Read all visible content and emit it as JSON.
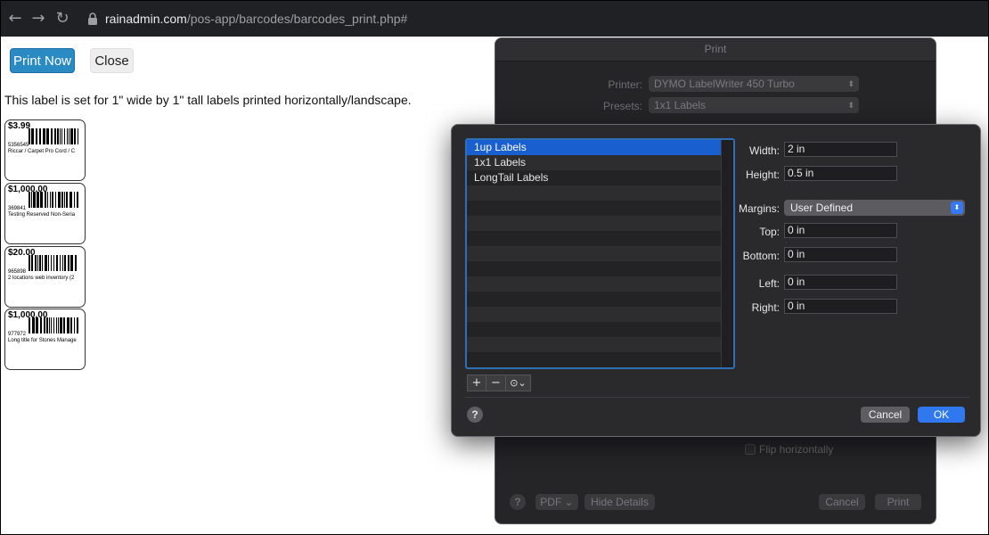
{
  "browser": {
    "url_host": "rainadmin.com",
    "url_path": "/pos-app/barcodes/barcodes_print.php#"
  },
  "page": {
    "print_now": "Print Now",
    "close": "Close",
    "note": "This label is set for 1\" wide by 1\" tall labels printed horizontally/landscape.",
    "labels": [
      {
        "price": "$3.99",
        "sku": "5356545",
        "desc": "Riccar / Carpet Pro Cord / C"
      },
      {
        "price": "$1,000.00",
        "sku": "369841",
        "desc": "Testing Reserved Non-Seria"
      },
      {
        "price": "$20.00",
        "sku": "965898",
        "desc": "2 locations web inventory (2"
      },
      {
        "price": "$1,000.00",
        "sku": "977972",
        "desc": "Long title for Stones Manage"
      }
    ]
  },
  "print_dialog": {
    "title": "Print",
    "printer_label": "Printer:",
    "printer_value": "DYMO LabelWriter 450 Turbo",
    "presets_label": "Presets:",
    "presets_value": "1x1 Labels",
    "flip_label": "Flip horizontally",
    "pdf_label": "PDF",
    "hide_details": "Hide Details",
    "cancel": "Cancel",
    "print": "Print"
  },
  "paper_sheet": {
    "list_items": [
      "1up Labels",
      "1x1 Labels",
      "LongTail Labels",
      "",
      "",
      "",
      "",
      "",
      "",
      "",
      "",
      "",
      "",
      "",
      ""
    ],
    "selected_index": 0,
    "add_symbol": "+",
    "remove_symbol": "−",
    "width_label": "Width:",
    "width_value": "2 in",
    "height_label": "Height:",
    "height_value": "0.5 in",
    "margins_label": "Margins:",
    "margins_value": "User Defined",
    "top_label": "Top:",
    "top_value": "0 in",
    "bottom_label": "Bottom:",
    "bottom_value": "0 in",
    "left_label": "Left:",
    "left_value": "0 in",
    "right_label": "Right:",
    "right_value": "0 in",
    "help": "?",
    "cancel": "Cancel",
    "ok": "OK"
  }
}
